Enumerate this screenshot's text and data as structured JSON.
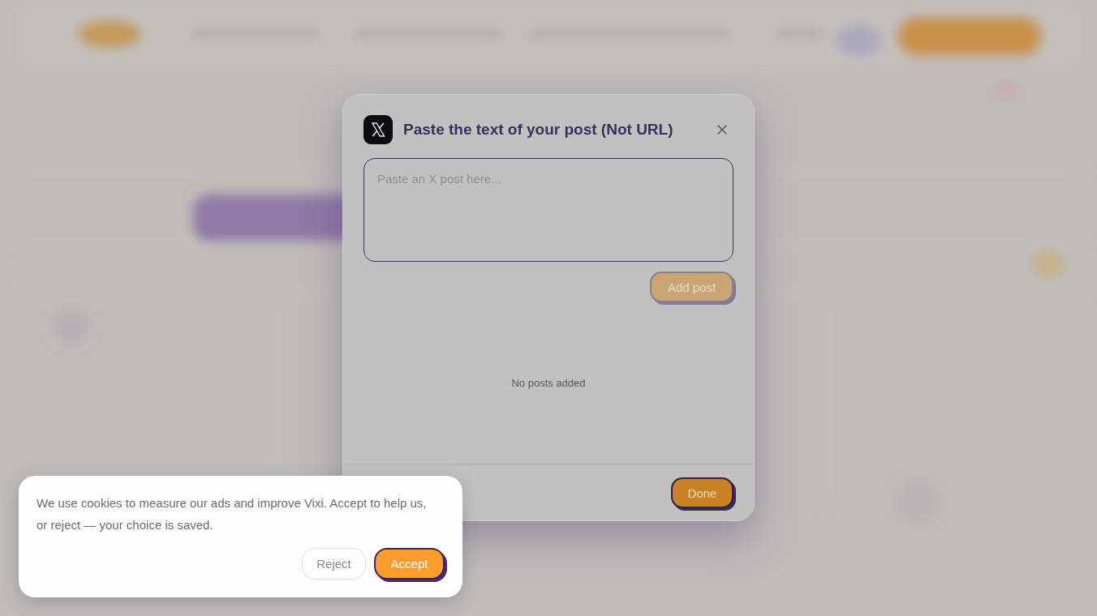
{
  "dialog": {
    "title": "Paste the text of your post (Not URL)",
    "post_field": {
      "placeholder": "Paste an X post here..."
    },
    "add_button": {
      "label": "Add post",
      "disabled": true
    },
    "empty_message": "No posts added",
    "done_button": {
      "label": "Done"
    }
  },
  "cookie_banner": {
    "message": "We use cookies to measure our ads and improve Vixi. Accept to help us, or reject — your choice is saved.",
    "buttons": [
      {
        "label": "Reject",
        "kind": "secondary"
      },
      {
        "label": "Accept",
        "kind": "primary"
      }
    ]
  }
}
